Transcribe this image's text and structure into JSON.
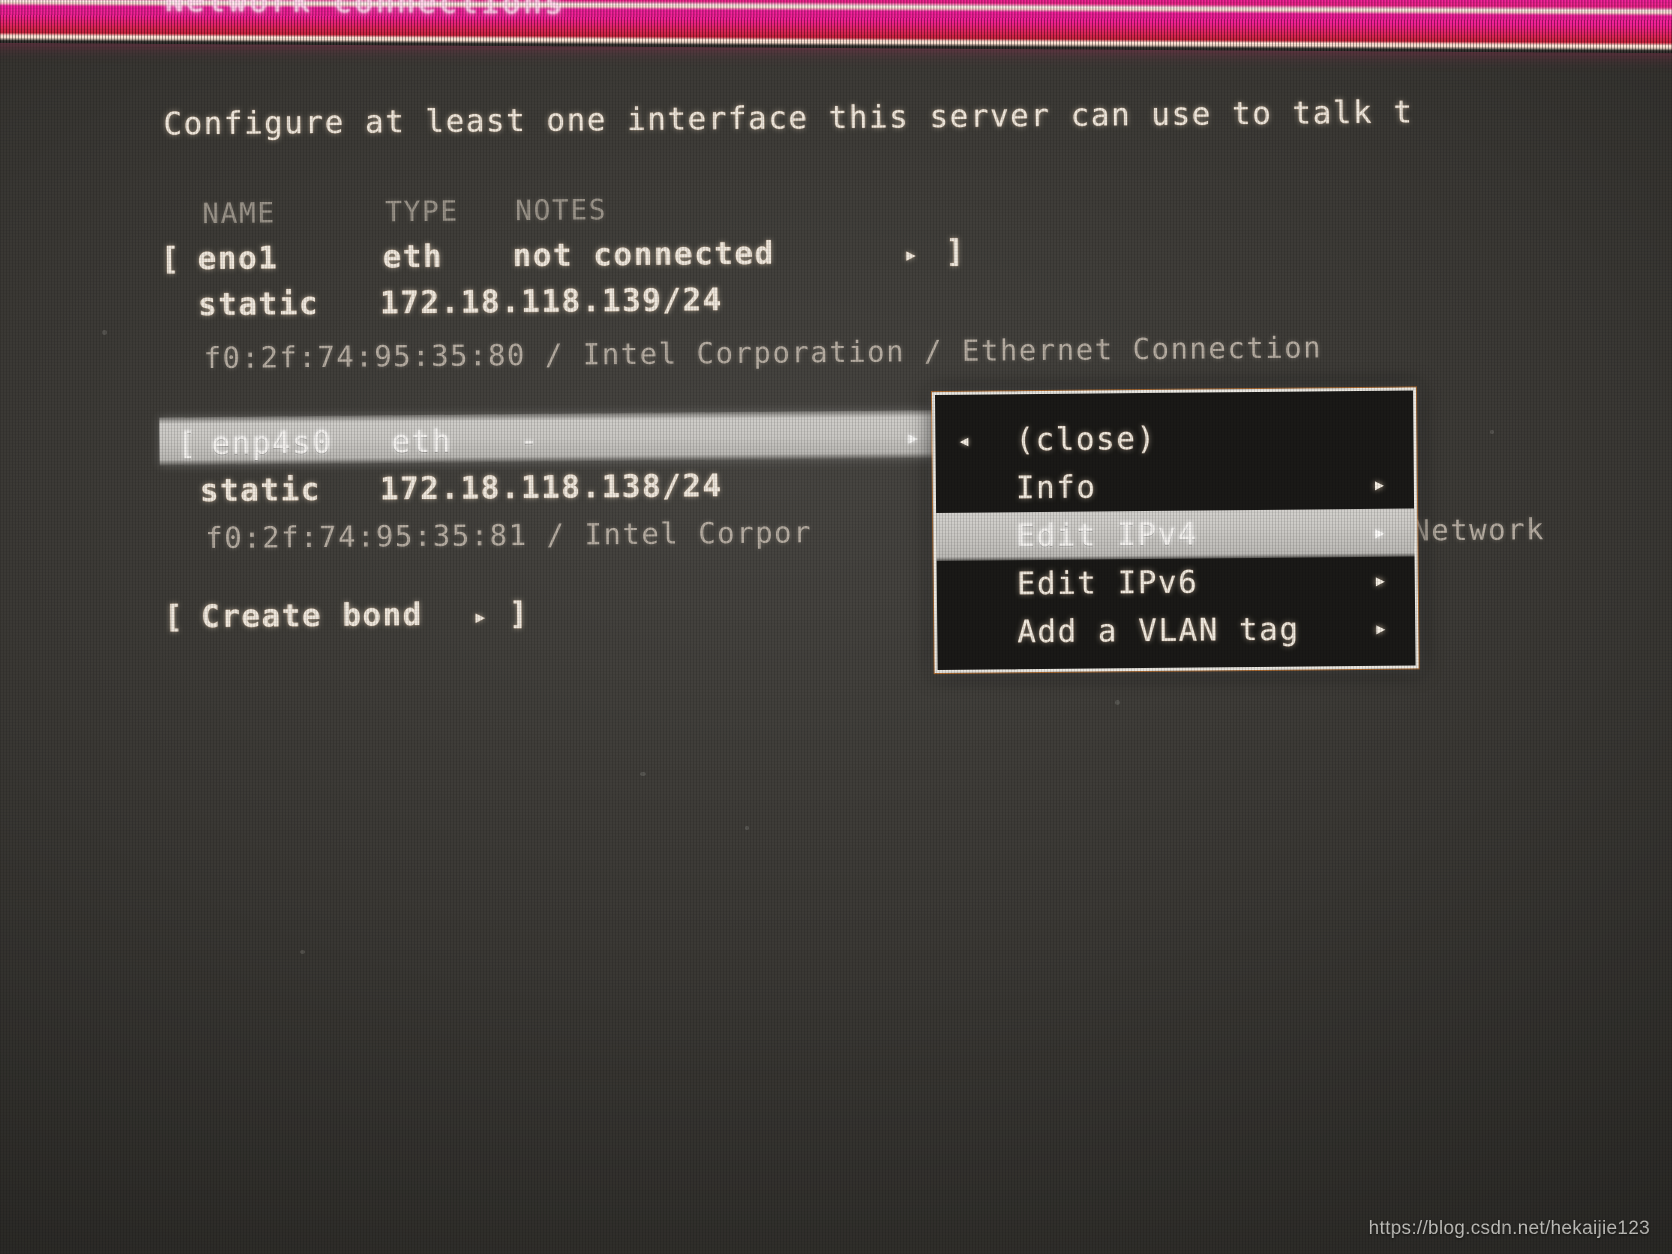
{
  "header": {
    "title": "Network connections",
    "bar_color": "#f3179a",
    "accent_color": "#d41b2e"
  },
  "main": {
    "instruction": "Configure at least one interface this server can use to talk t",
    "columns": {
      "name": "NAME",
      "type": "TYPE",
      "notes": "NOTES"
    },
    "interfaces": [
      {
        "bracket_open": "[",
        "name": "eno1",
        "type": "eth",
        "notes": "not connected",
        "arrow": "▸",
        "bracket_close": "]",
        "address_mode": "static",
        "address": "172.18.118.139/24",
        "hardware": "f0:2f:74:95:35:80 / Intel Corporation / Ethernet Connection",
        "selected": false
      },
      {
        "bracket_open": "[",
        "name": "enp4s0",
        "type": "eth",
        "notes": "-",
        "arrow": "▸",
        "bracket_close": "]",
        "address_mode": "static",
        "address": "172.18.118.138/24",
        "hardware": "f0:2f:74:95:35:81 / Intel Corpor",
        "hardware_tail": "Network",
        "selected": true
      }
    ],
    "create_bond": {
      "bracket_open": "[",
      "label": "Create bond",
      "arrow": "▸",
      "bracket_close": "]"
    }
  },
  "context_menu": {
    "items": [
      {
        "label": "(close)",
        "left_arrow": "◂",
        "right_arrow": "",
        "selected": false
      },
      {
        "label": "Info",
        "left_arrow": "",
        "right_arrow": "▸",
        "selected": false
      },
      {
        "label": "Edit IPv4",
        "left_arrow": "",
        "right_arrow": "▸",
        "selected": true
      },
      {
        "label": "Edit IPv6",
        "left_arrow": "",
        "right_arrow": "▸",
        "selected": false
      },
      {
        "label": "Add a VLAN tag",
        "left_arrow": "",
        "right_arrow": "▸",
        "selected": false
      }
    ]
  },
  "watermark": {
    "text": "https://blog.csdn.net/hekaijie123"
  }
}
